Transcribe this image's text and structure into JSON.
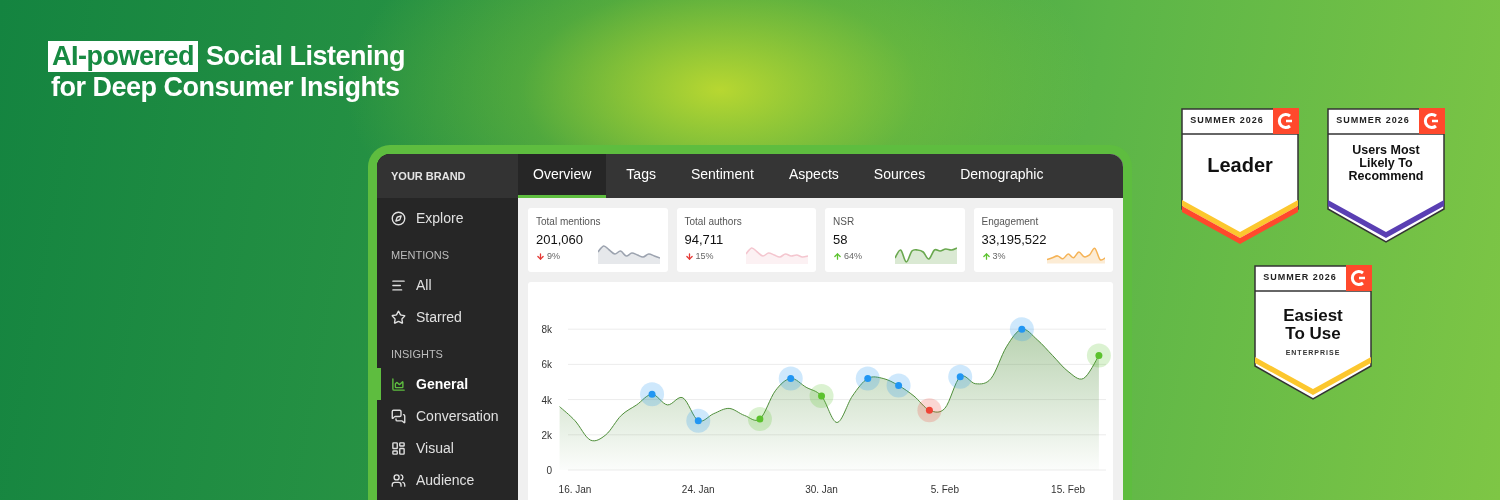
{
  "headline": {
    "highlight": "AI-powered",
    "text_after": "Social Listening",
    "second_line": "for Deep Consumer Insights"
  },
  "app": {
    "brand": "YOUR BRAND",
    "tabs": [
      {
        "label": "Overview",
        "selected": true
      },
      {
        "label": "Tags",
        "selected": false
      },
      {
        "label": "Sentiment",
        "selected": false
      },
      {
        "label": "Aspects",
        "selected": false
      },
      {
        "label": "Sources",
        "selected": false
      },
      {
        "label": "Demographic",
        "selected": false
      }
    ],
    "sidebar": [
      {
        "items": [
          {
            "label": "Explore",
            "selected": false
          }
        ]
      },
      {
        "heading": "MENTIONS",
        "items": [
          {
            "label": "All",
            "selected": false
          },
          {
            "label": "Starred",
            "selected": false
          }
        ]
      },
      {
        "heading": "INSIGHTS",
        "items": [
          {
            "label": "General",
            "selected": true
          },
          {
            "label": "Conversation",
            "selected": false
          },
          {
            "label": "Visual",
            "selected": false
          },
          {
            "label": "Audience",
            "selected": false
          }
        ]
      }
    ],
    "kpis": [
      {
        "label": "Total mentions",
        "value": "201,060",
        "rising": false,
        "change": "9%",
        "color": "#9ca3af"
      },
      {
        "label": "Total authors",
        "value": "94,711",
        "rising": false,
        "change": "15%",
        "color": "#f4c6cf"
      },
      {
        "label": "NSR",
        "value": "58",
        "rising": true,
        "change": "64%",
        "color": "#6aa84f"
      },
      {
        "label": "Engagement",
        "value": "33,195,522",
        "rising": true,
        "change": "3%",
        "color": "#f5b356"
      }
    ],
    "chart_markers": [
      {
        "color": "#2196f3"
      },
      {
        "color": "#2196f3"
      },
      {
        "color": "#5cc22e"
      },
      {
        "color": "#2196f3"
      },
      {
        "color": "#5cc22e"
      },
      {
        "color": "#2196f3"
      },
      {
        "color": "#2196f3"
      },
      {
        "color": "#ef4436"
      },
      {
        "color": "#2196f3"
      },
      {
        "color": "#2196f3"
      },
      {
        "color": "#5cc22e"
      }
    ],
    "chart_data": {
      "type": "area",
      "grid": true,
      "ylim": [
        0,
        8000
      ],
      "categories": [
        null,
        "16. Jan",
        null,
        null,
        null,
        null,
        null,
        null,
        null,
        "24. Jan",
        null,
        null,
        null,
        null,
        null,
        null,
        null,
        "30. Jan",
        null,
        null,
        null,
        null,
        null,
        null,
        null,
        "5. Feb",
        null,
        null,
        null,
        null,
        null,
        null,
        null,
        "15. Feb",
        null,
        null
      ],
      "series": [
        {
          "color": "#4f8f3a",
          "values": [
            3600,
            2800,
            1700,
            2000,
            3100,
            3700,
            4300,
            3700,
            4100,
            2800,
            3200,
            3500,
            3100,
            2900,
            4500,
            5200,
            4700,
            4200,
            2700,
            4200,
            5200,
            5200,
            4800,
            4200,
            3400,
            3500,
            5300,
            4900,
            5200,
            7000,
            8000,
            7400,
            6500,
            5600,
            5200,
            6500
          ]
        }
      ],
      "yticks": [
        {
          "value": 0,
          "label": "0"
        },
        {
          "value": 2000,
          "label": "2k"
        },
        {
          "value": 4000,
          "label": "4k"
        },
        {
          "value": 6000,
          "label": "6k"
        },
        {
          "value": 8000,
          "label": "8k"
        }
      ]
    }
  },
  "badges": [
    {
      "season": "SUMMER 2026",
      "title": "Leader",
      "stripes": [
        {
          "color": "#fcc72e"
        },
        {
          "color": "#ff492c"
        }
      ]
    },
    {
      "season": "SUMMER 2026",
      "title": "Users Most Likely To Recommend",
      "stripes": [
        {
          "color": "#5a3fb3"
        }
      ]
    },
    {
      "season": "SUMMER 2026",
      "title": "Easiest To Use",
      "subtitle": "ENTERPRISE",
      "stripes": [
        {
          "color": "#fcc72e"
        }
      ]
    }
  ]
}
